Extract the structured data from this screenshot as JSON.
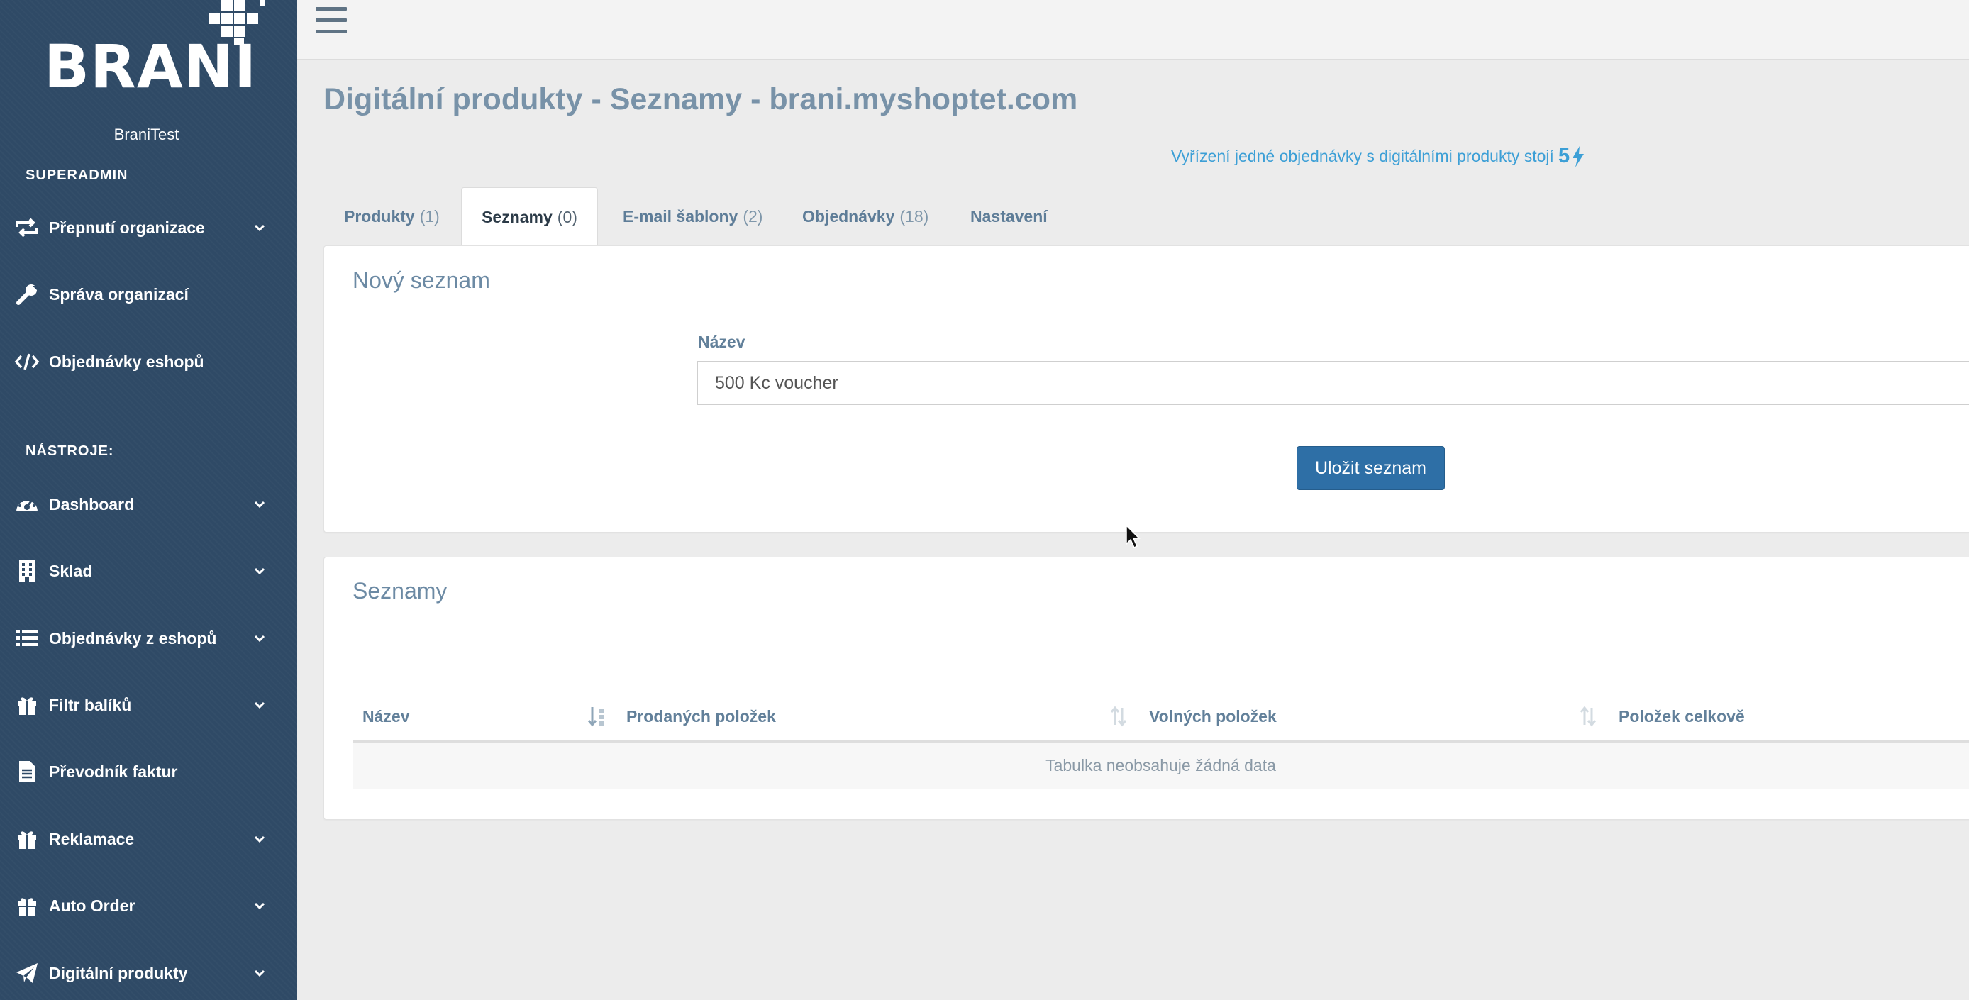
{
  "brand": {
    "logo_text": "BRANI",
    "org_name": "BraniTest"
  },
  "sidebar": {
    "section_superadmin": "SUPERADMIN",
    "superadmin_items": [
      {
        "label": "Přepnutí organizace",
        "icon": "switch-icon",
        "has_chevron": true
      },
      {
        "label": "Správa organizací",
        "icon": "wrench-icon",
        "has_chevron": false
      },
      {
        "label": "Objednávky eshopů",
        "icon": "code-icon",
        "has_chevron": false
      }
    ],
    "section_tools": "NÁSTROJE:",
    "tool_items": [
      {
        "label": "Dashboard",
        "icon": "dashboard-icon",
        "has_chevron": true
      },
      {
        "label": "Sklad",
        "icon": "building-icon",
        "has_chevron": true
      },
      {
        "label": "Objednávky z eshopů",
        "icon": "list-icon",
        "has_chevron": true
      },
      {
        "label": "Filtr balíků",
        "icon": "gift-icon",
        "has_chevron": true
      },
      {
        "label": "Převodník faktur",
        "icon": "document-icon",
        "has_chevron": false
      },
      {
        "label": "Reklamace",
        "icon": "gift-icon",
        "has_chevron": true
      },
      {
        "label": "Auto Order",
        "icon": "gift-icon",
        "has_chevron": true
      },
      {
        "label": "Digitální produkty",
        "icon": "paper-plane-icon",
        "has_chevron": true
      }
    ]
  },
  "page": {
    "title": "Digitální produkty - Seznamy - brani.myshoptet.com",
    "price_note": "Vyřízení jedné objednávky s digitálními produkty stojí",
    "price_value": "5"
  },
  "tabs": [
    {
      "label": "Produkty",
      "count": "(1)",
      "active": false
    },
    {
      "label": "Seznamy",
      "count": "(0)",
      "active": true
    },
    {
      "label": "E-mail šablony",
      "count": "(2)",
      "active": false
    },
    {
      "label": "Objednávky",
      "count": "(18)",
      "active": false
    },
    {
      "label": "Nastavení",
      "count": "",
      "active": false
    }
  ],
  "new_list": {
    "title": "Nový seznam",
    "name_label": "Název",
    "name_value": "500 Kc voucher",
    "save_label": "Uložit seznam"
  },
  "lists": {
    "title": "Seznamy",
    "columns": [
      "Název",
      "Prodaných položek",
      "Volných položek",
      "Položek celkově"
    ],
    "empty_text": "Tabulka neobsahuje žádná data"
  },
  "colors": {
    "sidebar_bg": "#2f4a66",
    "primary_button": "#2e6fa6",
    "accent_link": "#3c9fd6",
    "title_text": "#7892a8"
  }
}
